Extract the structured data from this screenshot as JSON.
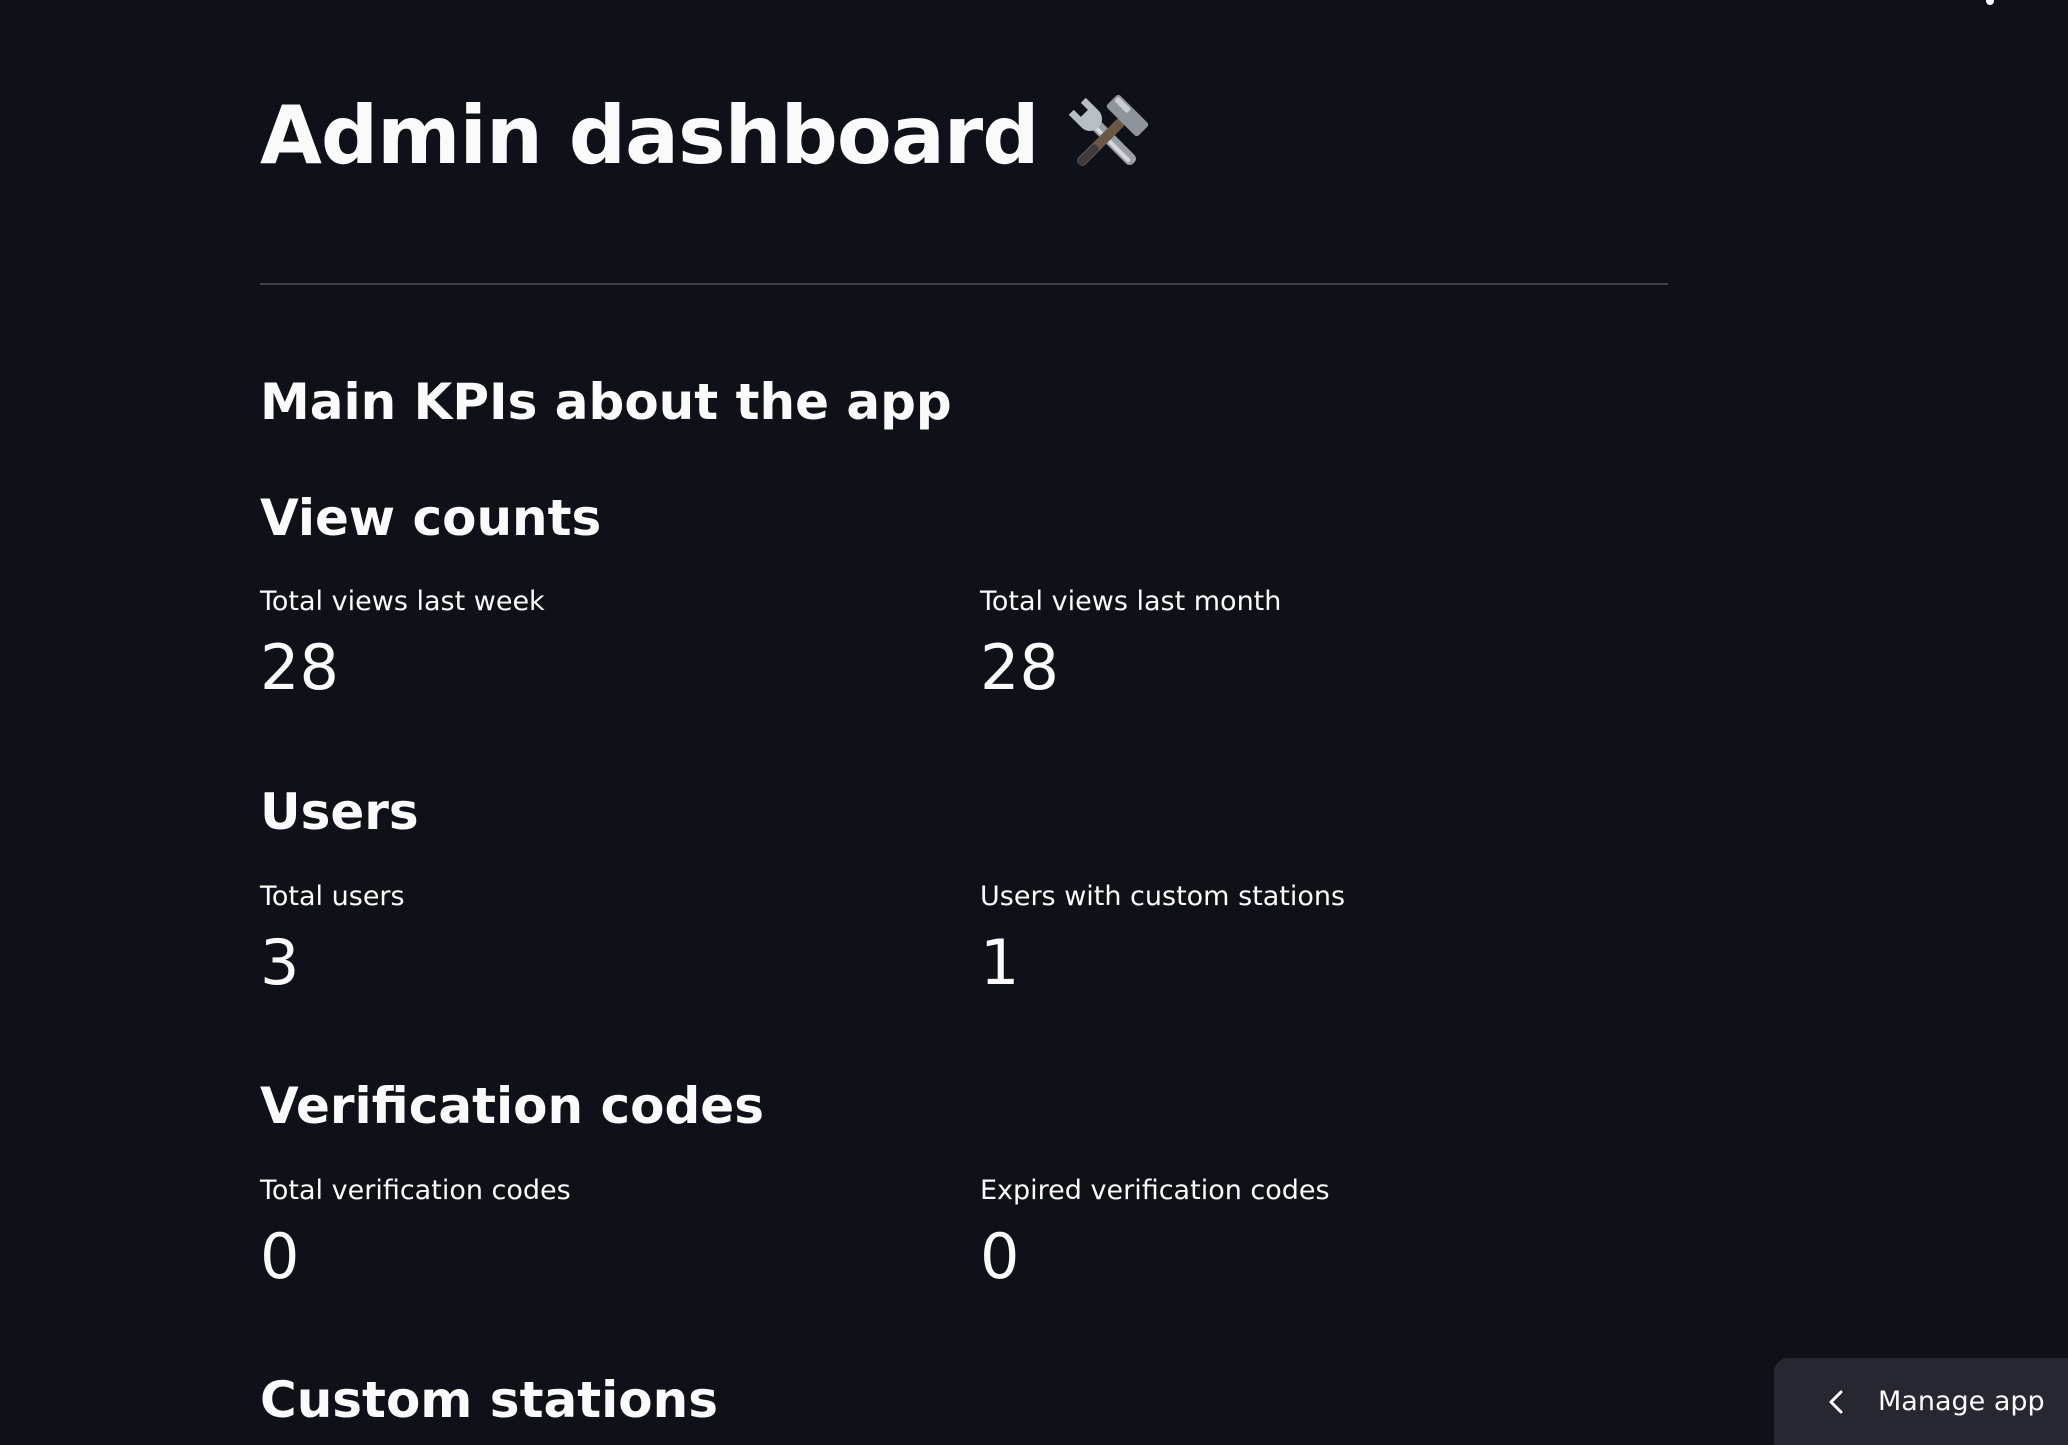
{
  "header": {
    "title": "Admin dashboard",
    "title_icon": "hammer-and-wrench-icon"
  },
  "main": {
    "subtitle": "Main KPIs about the app",
    "sections": [
      {
        "heading": "View counts",
        "metrics": [
          {
            "label": "Total views last week",
            "value": "28"
          },
          {
            "label": "Total views last month",
            "value": "28"
          }
        ]
      },
      {
        "heading": "Users",
        "metrics": [
          {
            "label": "Total users",
            "value": "3"
          },
          {
            "label": "Users with custom stations",
            "value": "1"
          }
        ]
      },
      {
        "heading": "Verification codes",
        "metrics": [
          {
            "label": "Total verification codes",
            "value": "0"
          },
          {
            "label": "Expired verification codes",
            "value": "0"
          }
        ]
      },
      {
        "heading": "Custom stations"
      }
    ]
  },
  "footer": {
    "manage_app_label": "Manage app",
    "manage_app_icon": "chevron-left-icon"
  },
  "colors": {
    "background": "#0e1117",
    "text": "#fafafa",
    "divider": "#3d4049",
    "manage_panel": "#262730"
  }
}
